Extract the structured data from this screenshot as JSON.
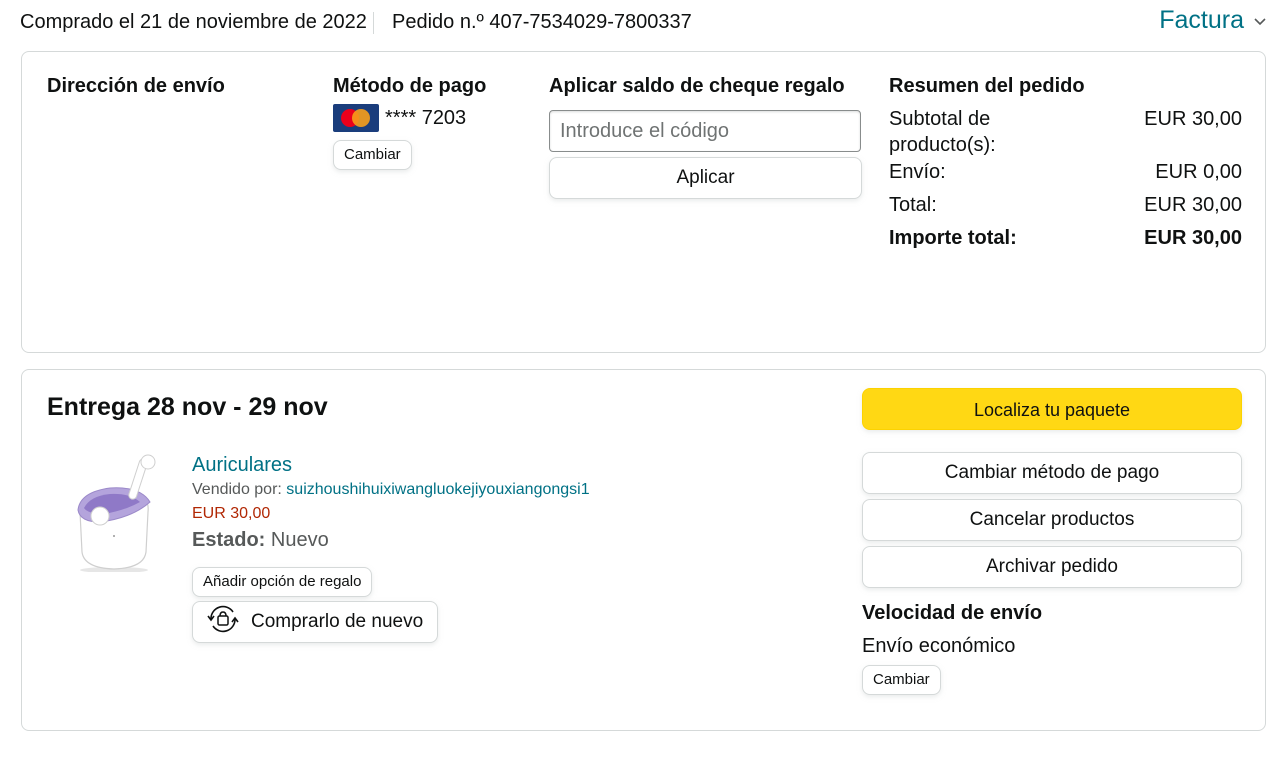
{
  "header": {
    "purchase_date": "Comprado el 21 de noviembre de 2022",
    "order_number": "Pedido n.º 407-7534029-7800337",
    "invoice_label": "Factura"
  },
  "shipping": {
    "heading": "Dirección de envío"
  },
  "payment": {
    "heading": "Método de pago",
    "card_masked": "**** 7203",
    "change_label": "Cambiar"
  },
  "gift_card": {
    "heading": "Aplicar saldo de cheque regalo",
    "placeholder": "Introduce el código",
    "apply_label": "Aplicar"
  },
  "summary": {
    "heading": "Resumen del pedido",
    "rows": [
      {
        "label": "Subtotal de producto(s):",
        "value": "EUR 30,00"
      },
      {
        "label": "Envío:",
        "value": "EUR 0,00"
      },
      {
        "label": "Total:",
        "value": "EUR 30,00"
      }
    ],
    "grand_total": {
      "label": "Importe total:",
      "value": "EUR 30,00"
    }
  },
  "delivery": {
    "title": "Entrega 28 nov - 29 nov",
    "product": {
      "name": "Auriculares",
      "seller_prefix": "Vendido por: ",
      "seller_name": "suizhoushihuixiwangluokejiyouxiangongsi1",
      "price": "EUR 30,00",
      "condition_label": "Estado:",
      "condition_value": "Nuevo",
      "gift_option_label": "Añadir opción de regalo",
      "buy_again_label": "Comprarlo de nuevo"
    },
    "actions": {
      "track_label": "Localiza tu paquete",
      "change_payment_label": "Cambiar método de pago",
      "cancel_label": "Cancelar productos",
      "archive_label": "Archivar pedido"
    },
    "shipping_speed": {
      "heading": "Velocidad de envío",
      "value": "Envío económico",
      "change_label": "Cambiar"
    }
  },
  "colors": {
    "link": "#007185",
    "price": "#b12704",
    "primary_button": "#ffd814",
    "border": "#d5d9d9"
  },
  "icons": {
    "card_brand": "mastercard-icon",
    "buy_again": "buy-again-icon",
    "invoice_toggle": "chevron-down-icon"
  }
}
